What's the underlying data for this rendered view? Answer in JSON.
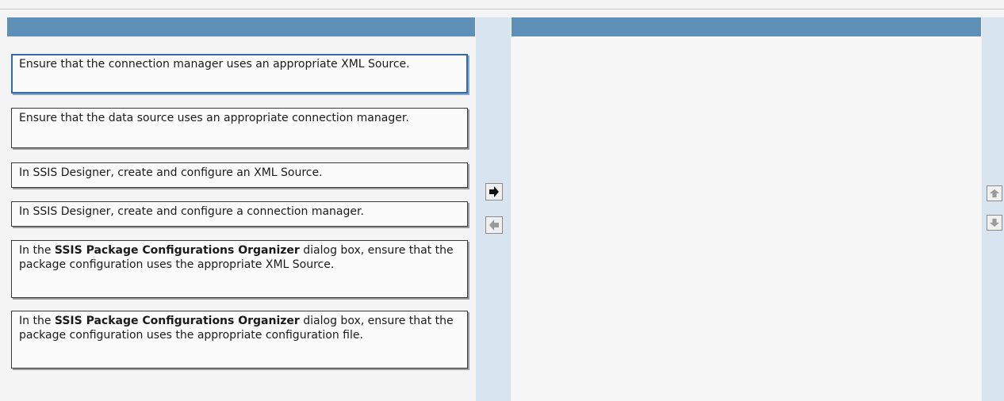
{
  "choices": [
    {
      "parts": [
        {
          "text": "Ensure that the connection manager uses an appropriate XML Source.",
          "bold": false
        }
      ],
      "selected": true
    },
    {
      "parts": [
        {
          "text": "Ensure that the data source uses an appropriate connection manager.",
          "bold": false
        }
      ],
      "selected": false
    },
    {
      "parts": [
        {
          "text": "In SSIS Designer, create and configure an XML Source.",
          "bold": false
        }
      ],
      "selected": false
    },
    {
      "parts": [
        {
          "text": "In SSIS Designer, create and configure a connection manager.",
          "bold": false
        }
      ],
      "selected": false
    },
    {
      "parts": [
        {
          "text": "In the ",
          "bold": false
        },
        {
          "text": "SSIS Package Configurations Organizer",
          "bold": true
        },
        {
          "text": " dialog box, ensure that the package configuration uses the appropriate XML Source.",
          "bold": false
        }
      ],
      "selected": false
    },
    {
      "parts": [
        {
          "text": "In the ",
          "bold": false
        },
        {
          "text": "SSIS Package Configurations Organizer",
          "bold": true
        },
        {
          "text": " dialog box, ensure that the package configuration uses the appropriate configuration file.",
          "bold": false
        }
      ],
      "selected": false
    }
  ],
  "answer_list": [],
  "icons": {
    "add": "arrow-right-icon",
    "remove": "arrow-left-icon",
    "move_up": "arrow-up-icon",
    "move_down": "arrow-down-icon"
  },
  "colors": {
    "header_bar": "#5d8fb7",
    "side_strip": "#d8e5f1",
    "selected_border": "#3569a7"
  }
}
